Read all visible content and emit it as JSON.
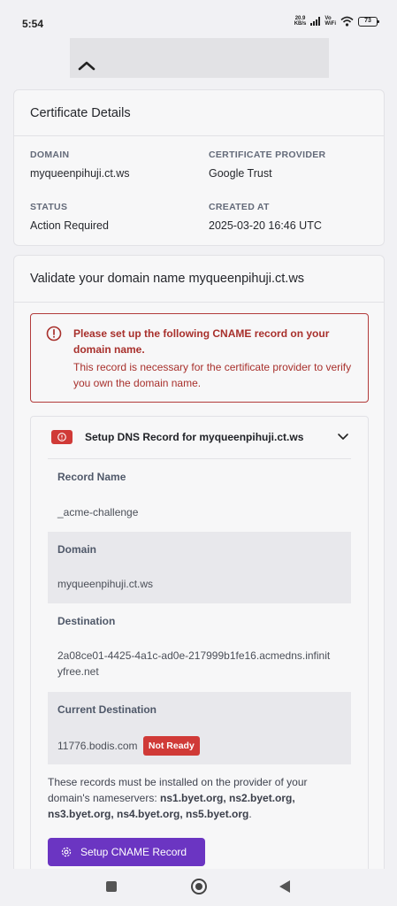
{
  "status_bar": {
    "time": "5:54",
    "net_speed_value": "20.9",
    "net_speed_unit": "KB/s",
    "network_label_top": "Vo",
    "network_label_bottom": "WiFi",
    "battery": "73"
  },
  "certificate_details": {
    "title": "Certificate Details",
    "domain_label": "DOMAIN",
    "domain_value": "myqueenpihuji.ct.ws",
    "provider_label": "CERTIFICATE PROVIDER",
    "provider_value": "Google Trust",
    "status_label": "STATUS",
    "status_value": "Action Required",
    "created_label": "CREATED AT",
    "created_value": "2025-03-20 16:46 UTC"
  },
  "validate": {
    "title": "Validate your domain name myqueenpihuji.ct.ws",
    "alert_title": "Please set up the following CNAME record on your domain name.",
    "alert_body": "This record is necessary for the certificate provider to verify you own the domain name.",
    "dns_title": "Setup DNS Record for myqueenpihuji.ct.ws",
    "record_name_label": "Record Name",
    "record_name_value": "_acme-challenge",
    "domain_label": "Domain",
    "domain_value": "myqueenpihuji.ct.ws",
    "destination_label": "Destination",
    "destination_value": "2a08ce01-4425-4a1c-ad0e-217999b1fe16.acmedns.infinityfree.net",
    "current_destination_label": "Current Destination",
    "current_destination_value": "11776.bodis.com",
    "not_ready_badge": "Not Ready",
    "note_prefix": "These records must be installed on the provider of your domain's nameservers: ",
    "nameservers": "ns1.byet.org, ns2.byet.org, ns3.byet.org, ns4.byet.org, ns5.byet.org",
    "note_suffix": ".",
    "setup_button": "Setup CNAME Record"
  },
  "colors": {
    "accent": "#6b35c2",
    "error": "#d03a37",
    "alert_text": "#a8302c"
  },
  "icons": [
    "chevron-up-icon",
    "alert-circle-icon",
    "error-badge-icon",
    "chevron-down-icon",
    "gear-icon"
  ]
}
